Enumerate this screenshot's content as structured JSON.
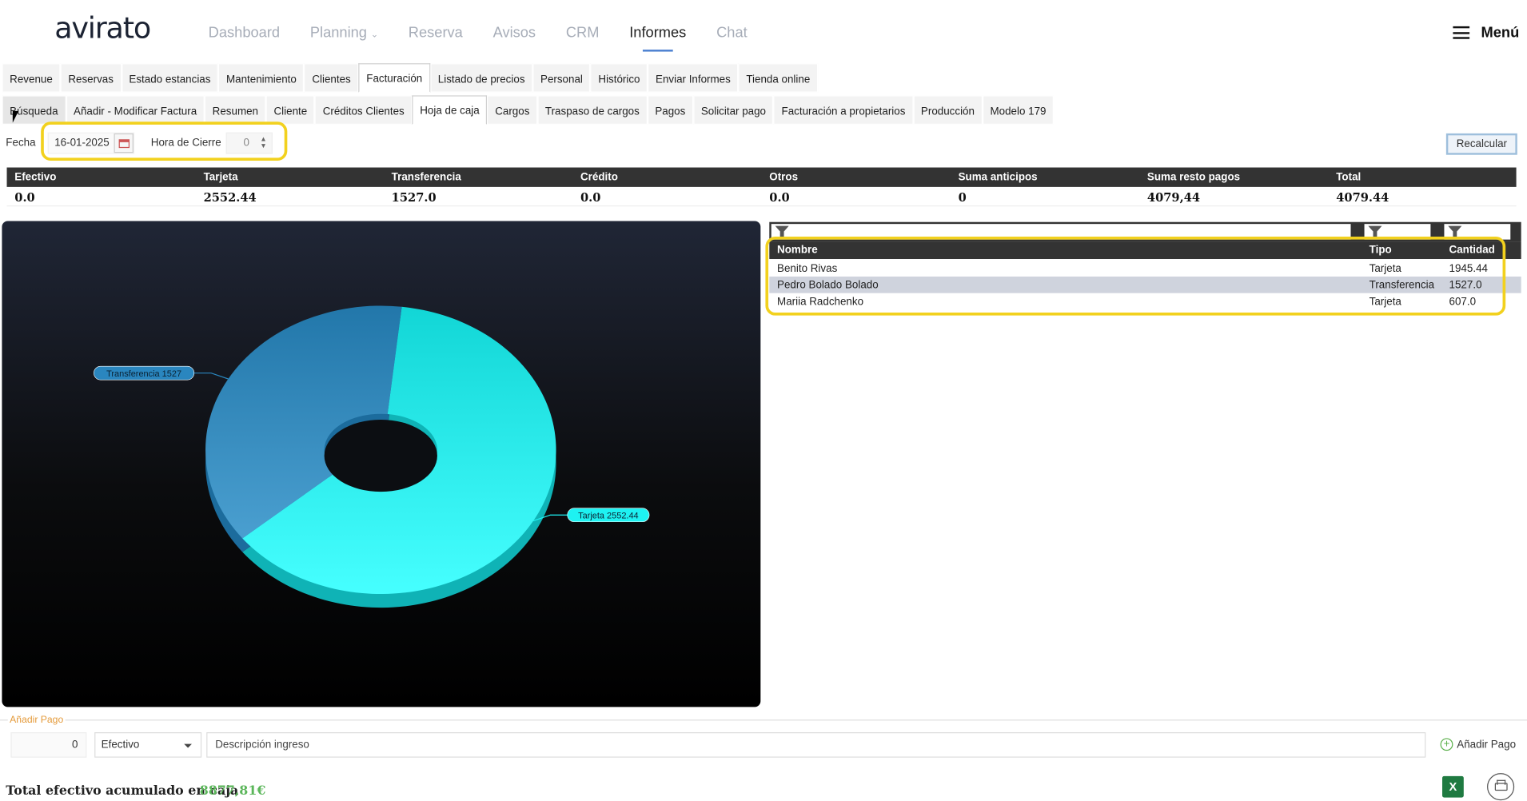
{
  "logo": "avirato",
  "nav": [
    {
      "label": "Dashboard"
    },
    {
      "label": "Planning"
    },
    {
      "label": "Reserva"
    },
    {
      "label": "Avisos"
    },
    {
      "label": "CRM"
    },
    {
      "label": "Informes"
    },
    {
      "label": "Chat"
    }
  ],
  "nav_active": "Informes",
  "menu_label": "Menú",
  "tabs1": [
    "Revenue",
    "Reservas",
    "Estado estancias",
    "Mantenimiento",
    "Clientes",
    "Facturación",
    "Listado de precios",
    "Personal",
    "Histórico",
    "Enviar Informes",
    "Tienda online"
  ],
  "tabs1_active": "Facturación",
  "tabs2": [
    "Búsqueda",
    "Añadir - Modificar Factura",
    "Resumen",
    "Cliente",
    "Créditos Clientes",
    "Hoja de caja",
    "Cargos",
    "Traspaso de cargos",
    "Pagos",
    "Solicitar pago",
    "Facturación a propietarios",
    "Producción",
    "Modelo 179"
  ],
  "tabs2_active": "Hoja de caja",
  "filters": {
    "fecha_label": "Fecha",
    "fecha_value": "16-01-2025",
    "hora_label": "Hora de Cierre",
    "hora_value": "0"
  },
  "recalcular": "Recalcular",
  "summary": {
    "headers": [
      "Efectivo",
      "Tarjeta",
      "Transferencia",
      "Crédito",
      "Otros",
      "Suma anticipos",
      "Suma resto pagos",
      "Total"
    ],
    "values": [
      "0.0",
      "2552.44",
      "1527.0",
      "0.0",
      "0.0",
      "0",
      "4079,44",
      "4079.44"
    ]
  },
  "chart_data": {
    "type": "pie",
    "categories": [
      "Tarjeta",
      "Transferencia"
    ],
    "values": [
      2552.44,
      1527
    ],
    "labels": [
      "Tarjeta  2552.44",
      "Transferencia  1527"
    ],
    "colors": [
      "#1ef2f2",
      "#2a86bf"
    ]
  },
  "grid": {
    "headers": [
      "Nombre",
      "Tipo",
      "Cantidad"
    ],
    "rows": [
      [
        "Benito Rivas",
        "Tarjeta",
        "1945.44"
      ],
      [
        "Pedro Bolado Bolado",
        "Transferencia",
        "1527.0"
      ],
      [
        "Mariia Radchenko",
        "Tarjeta",
        "607.0"
      ]
    ]
  },
  "add_pago": {
    "section_label": "Añadir Pago",
    "amount": "0",
    "method": "Efectivo",
    "description_placeholder": "Descripción ingreso",
    "button": "Añadir Pago"
  },
  "total": {
    "label": "Total efectivo acumulado en caja",
    "value": "8877,81€"
  },
  "excel_label": "X"
}
